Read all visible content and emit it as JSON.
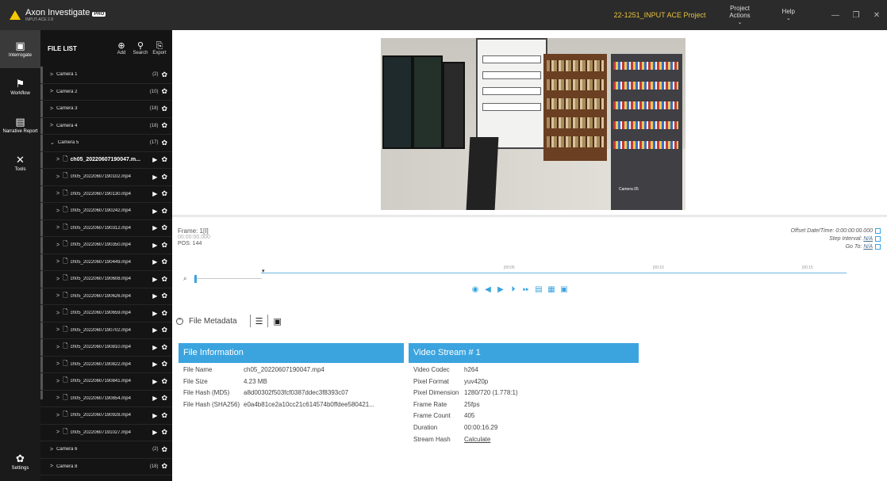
{
  "app": {
    "title": "Axon Investigate",
    "badge": "PRO",
    "subtitle": "INPUT-ACE 2.8",
    "project": "22-1251_INPUT ACE Project",
    "menus": [
      {
        "label": "Project Actions",
        "chevron": "⌄"
      },
      {
        "label": "Help",
        "chevron": "⌄"
      }
    ],
    "window_buttons": [
      "—",
      "❐",
      "✕"
    ]
  },
  "nav": [
    {
      "label": "Interrogate",
      "icon": "clipboard-icon",
      "glyph": "▣"
    },
    {
      "label": "Workflow",
      "icon": "workflow-icon",
      "glyph": "⚑"
    },
    {
      "label": "Narrative Report",
      "icon": "report-icon",
      "glyph": "▤"
    },
    {
      "label": "Tools",
      "icon": "tools-icon",
      "glyph": "✕"
    }
  ],
  "nav_settings": {
    "label": "Settings",
    "icon": "gear-icon",
    "glyph": "✿"
  },
  "file_list": {
    "title": "FILE LIST",
    "actions": [
      {
        "label": "Add",
        "glyph": "⊕"
      },
      {
        "label": "Search",
        "glyph": "⚲"
      },
      {
        "label": "Export",
        "glyph": "⎘"
      }
    ],
    "cameras_top": [
      {
        "name": "Camera 1",
        "count": "(2)"
      },
      {
        "name": "Camera 2",
        "count": "(10)"
      },
      {
        "name": "Camera 3",
        "count": "(18)"
      },
      {
        "name": "Camera 4",
        "count": "(18)"
      },
      {
        "name": "Camera 5",
        "count": "(17)"
      }
    ],
    "files": [
      "ch05_20220607190047.m...",
      "ch05_20220607190102.mp4",
      "ch05_20220607190130.mp4",
      "ch05_20220607190242.mp4",
      "ch05_20220607190312.mp4",
      "ch05_20220607190350.mp4",
      "ch05_20220607190449.mp4",
      "ch05_20220607190608.mp4",
      "ch05_20220607190626.mp4",
      "ch05_20220607190659.mp4",
      "ch05_20220607190702.mp4",
      "ch05_20220607190810.mp4",
      "ch05_20220607190822.mp4",
      "ch05_20220607190841.mp4",
      "ch05_20220607190854.mp4",
      "ch05_20220607190928.mp4",
      "ch05_20220607191027.mp4"
    ],
    "cameras_bottom": [
      {
        "name": "Camera 6",
        "count": "(2)"
      },
      {
        "name": "Camera 8",
        "count": "(18)"
      }
    ]
  },
  "video": {
    "camera_label": "Camera 05"
  },
  "timeline": {
    "frame_label": "Frame: 1[I]",
    "timecode": "00:00:00.000",
    "pos": "POS: 144",
    "offset_label": "Offset Date/Time:",
    "offset_value": "0:00:00:00.000",
    "step_label": "Step Interval:",
    "step_value": "N/A",
    "goto_label": "Go To:",
    "goto_value": "N/A",
    "ticks": [
      {
        "label": "|00:05",
        "pos": 0.415
      },
      {
        "label": "|00:10",
        "pos": 0.67
      },
      {
        "label": "|00:15",
        "pos": 0.924
      }
    ],
    "controls": [
      "camera-icon",
      "step-back-icon",
      "play-icon",
      "step-forward-icon",
      "fast-forward-icon",
      "frame-icon",
      "film-icon",
      "export-frame-icon"
    ]
  },
  "metadata": {
    "tab_label": "File Metadata",
    "file_info": {
      "title": "File Information",
      "rows": [
        {
          "k": "File Name",
          "v": "ch05_20220607190047.mp4"
        },
        {
          "k": "File Size",
          "v": "4.23 MB"
        },
        {
          "k": "File Hash (MD5)",
          "v": "a8d00302f503fcf0387ddec3f8393c07"
        },
        {
          "k": "File Hash (SHA256)",
          "v": "e0a4b81ce2a10cc21c614574b0ffdee580421..."
        }
      ]
    },
    "video_stream": {
      "title": "Video Stream # 1",
      "rows": [
        {
          "k": "Video Codec",
          "v": "h264"
        },
        {
          "k": "Pixel Format",
          "v": "yuv420p"
        },
        {
          "k": "Pixel Dimension",
          "v": "1280/720 (1.778:1)"
        },
        {
          "k": "Frame Rate",
          "v": "25fps"
        },
        {
          "k": "Frame Count",
          "v": "405"
        },
        {
          "k": "Duration",
          "v": "00:00:16.29"
        },
        {
          "k": "Stream Hash",
          "v": "Calculate"
        }
      ]
    }
  }
}
